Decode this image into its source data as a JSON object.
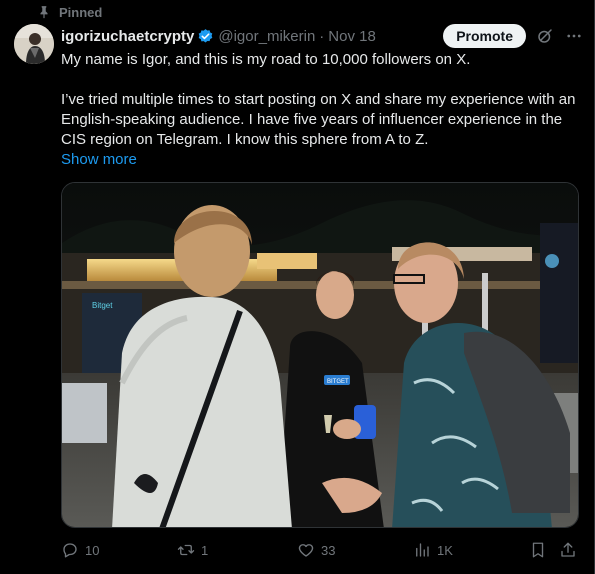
{
  "pinned_label": "Pinned",
  "author": {
    "display_name": "igorizuchaetcrypty",
    "handle": "@igor_mikerin",
    "separator": "·",
    "date": "Nov 18"
  },
  "promote_label": "Promote",
  "post": {
    "line1": "My name is Igor, and this is my road to 10,000 followers on X.",
    "paragraph2": "I’ve tried multiple times to start posting on X and share my experience with an English-speaking audience. I have five years of influencer experience in the CIS region on Telegram. I know this sphere from A to Z.",
    "show_more": "Show more"
  },
  "media": {
    "sign_text": "Bitget",
    "shirt_text": "BITGET"
  },
  "actions": {
    "replies": "10",
    "reposts": "1",
    "likes": "33",
    "views": "1K"
  },
  "colors": {
    "accent": "#1d9bf0",
    "muted": "#71767b",
    "text": "#e7e9ea",
    "verified": "#1d9bf0"
  },
  "icons": {
    "pinned": "pin-icon",
    "verified": "verified-badge-icon",
    "grok": "grok-icon",
    "more": "more-icon",
    "reply": "reply-icon",
    "repost": "repost-icon",
    "like": "heart-icon",
    "views": "views-icon",
    "bookmark": "bookmark-icon",
    "share": "share-icon"
  }
}
